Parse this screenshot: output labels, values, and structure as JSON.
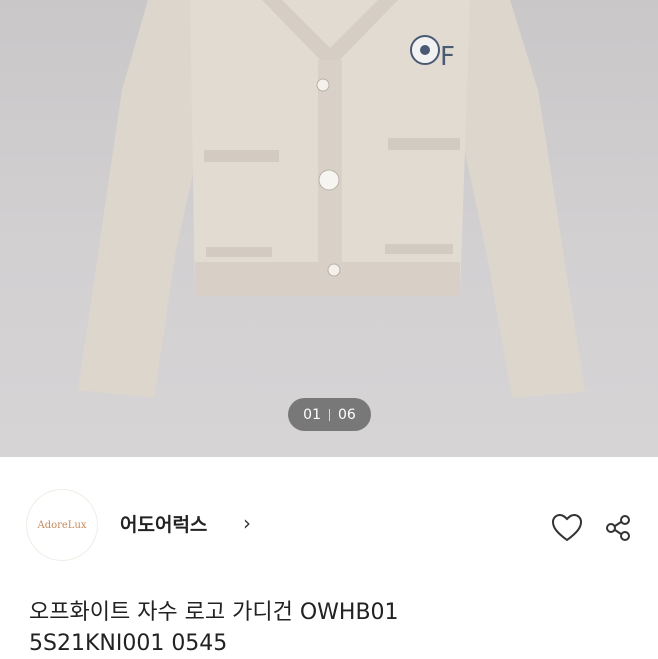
{
  "image_counter": {
    "current": "01",
    "total": "06"
  },
  "seller": {
    "logo_text": "AdoreLux",
    "name": "어도어럭스",
    "chevron": "›"
  },
  "actions": {
    "like_icon": "heart-icon",
    "share_icon": "share-icon"
  },
  "product": {
    "title": "오프화이트 자수 로고 가디건 OWHB01\n5S21KNI001 0545"
  },
  "colors": {
    "hero_bg": "#cfcdce",
    "cardigan": "#e0d9d0",
    "counter_bg": "#5f5f5f",
    "logo_accent": "#c48a5a"
  }
}
